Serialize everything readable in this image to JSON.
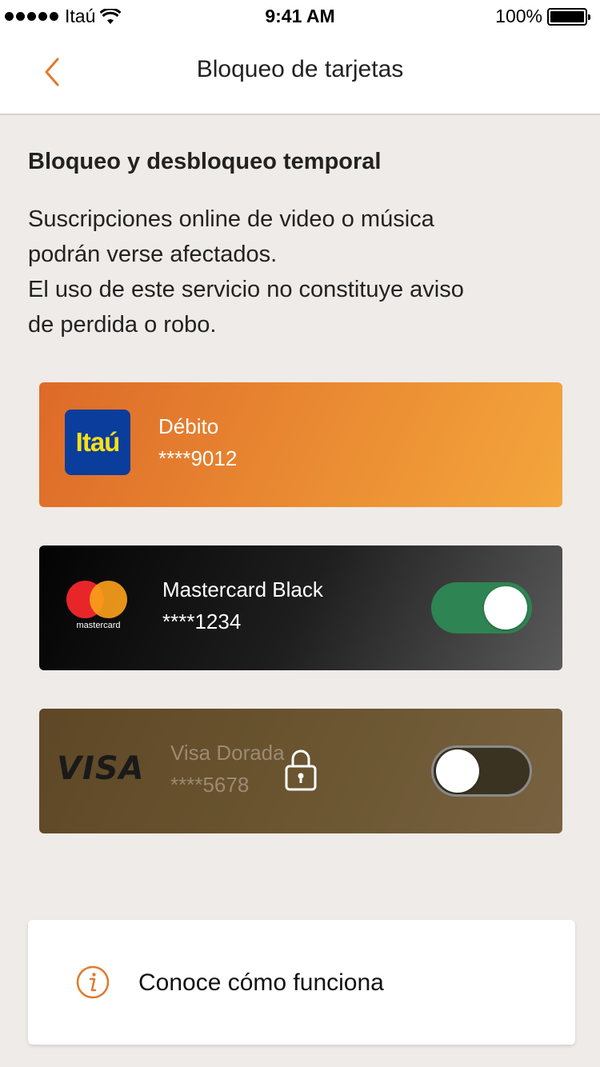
{
  "status_bar": {
    "carrier": "Itaú",
    "time": "9:41 AM",
    "battery": "100%"
  },
  "nav": {
    "title": "Bloqueo de tarjetas",
    "back_icon": "chevron-left-icon"
  },
  "section": {
    "title": "Bloqueo y desbloqueo temporal",
    "description_lines": [
      "Suscripciones online de video o música",
      "podrán verse afectados.",
      "El uso de este servicio no constituye aviso",
      "de perdida o robo."
    ]
  },
  "cards": [
    {
      "brand_logo": "Itaú",
      "name": "Débito",
      "number": "****9012",
      "has_toggle": false
    },
    {
      "brand_logo": "mastercard",
      "name": "Mastercard Black",
      "number": "****1234",
      "toggle_on": true
    },
    {
      "brand_logo": "VISA",
      "name": "Visa Dorada",
      "number": "****5678",
      "toggle_on": false,
      "locked": true
    }
  ],
  "info": {
    "label": "Conoce cómo funciona",
    "icon": "info-icon"
  },
  "colors": {
    "accent": "#e07a2e",
    "background": "#efebe8",
    "toggle_on": "#2f8453",
    "debit_card": "#e98932",
    "master_card": "#1e1e1e",
    "visa_card": "#6a5530"
  }
}
